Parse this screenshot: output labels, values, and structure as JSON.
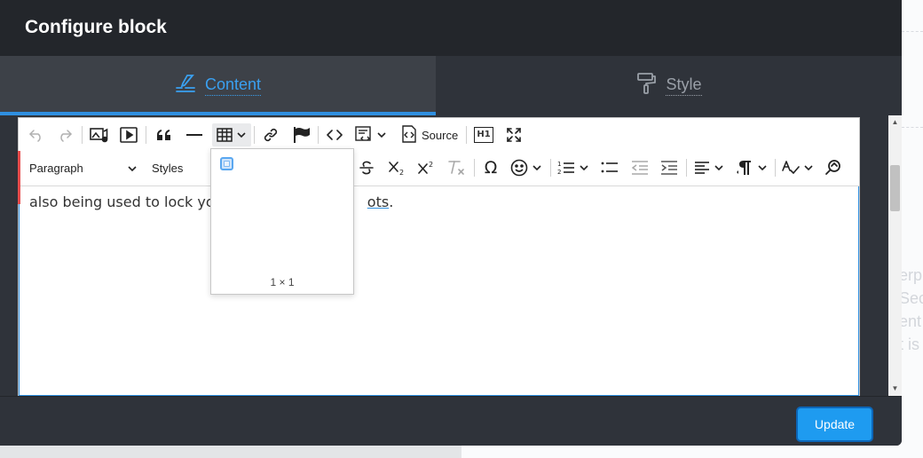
{
  "modal": {
    "title": "Configure block",
    "tabs": [
      {
        "label": "Content",
        "icon": "edit-lines-icon",
        "active": true
      },
      {
        "label": "Style",
        "icon": "paint-roller-icon",
        "active": false
      }
    ],
    "update_label": "Update"
  },
  "editor": {
    "toolbar_row1": {
      "buttons": [
        "undo-icon",
        "redo-icon",
        "image-icon",
        "media-icon",
        "blockquote-icon",
        "horizontal-line-icon",
        "table-icon",
        "link-icon",
        "bookmark-icon",
        "code-icon",
        "html-embed-icon",
        "source-editing-icon",
        "heading-icon",
        "fullscreen-icon"
      ],
      "source_label": "Source",
      "heading_badge": "H1"
    },
    "toolbar_row2": {
      "paragraph_label": "Paragraph",
      "styles_label": "Styles",
      "buttons": [
        "strikethrough-icon",
        "subscript-icon",
        "superscript-icon",
        "remove-format-icon",
        "special-characters-icon",
        "emoji-icon",
        "numbered-list-icon",
        "bulleted-list-icon",
        "outdent-icon",
        "indent-icon",
        "align-icon",
        "text-direction-icon",
        "spell-check-icon",
        "find-replace-icon"
      ]
    },
    "content": {
      "text_before": "also being used to lock you",
      "link_text": "ots",
      "text_after": "."
    },
    "table_dropdown": {
      "size_label": "1 × 1"
    }
  },
  "colors": {
    "accent": "#1e9bf0",
    "modal_bg": "#23262b",
    "tab_active_bg": "#3d4148",
    "marker": "#e64b4b"
  }
}
